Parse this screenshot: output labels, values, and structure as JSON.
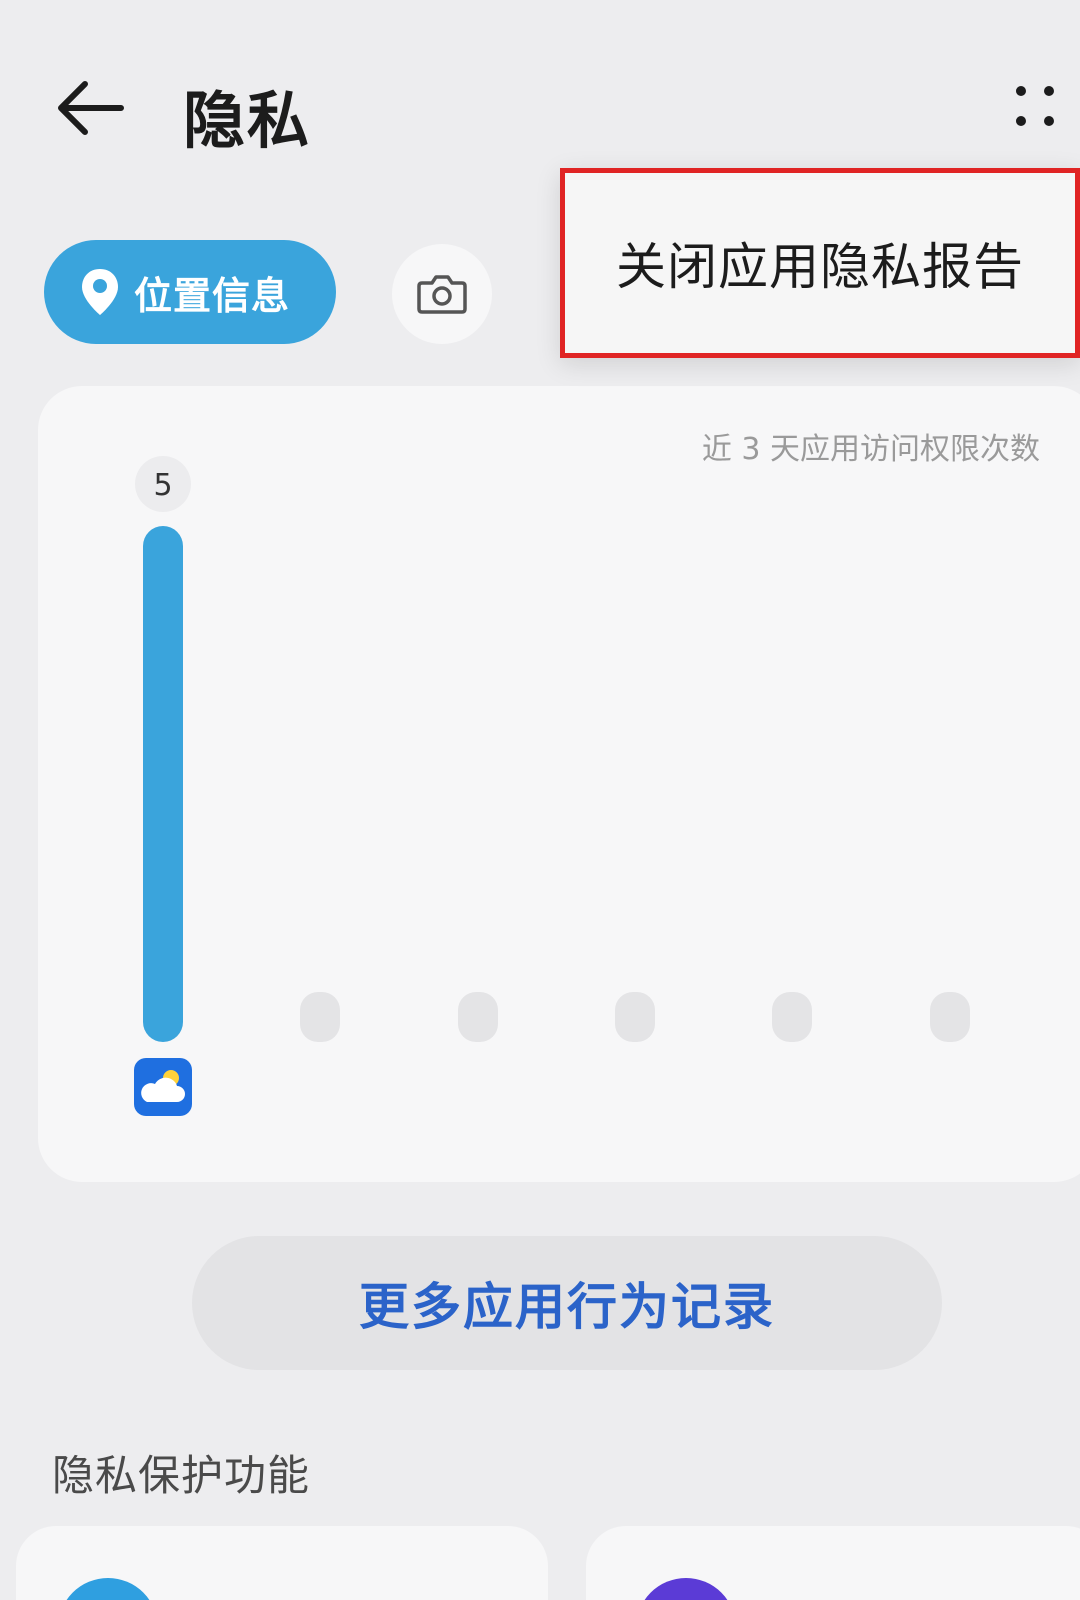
{
  "header": {
    "title": "隐私",
    "back_icon": "arrow-left-icon",
    "more_icon": "more-dots-icon"
  },
  "popup_menu": {
    "items": [
      "关闭应用隐私报告"
    ],
    "highlight_color": "#e02424"
  },
  "permission_tabs": [
    {
      "label": "位置信息",
      "icon": "location-pin-icon",
      "selected": true
    },
    {
      "label": "",
      "icon": "camera-icon",
      "selected": false
    }
  ],
  "chart_data": {
    "type": "bar",
    "title": "近 3 天应用访问权限次数",
    "categories": [
      "weather-app-icon",
      "",
      "",
      "",
      "",
      ""
    ],
    "values": [
      5,
      0,
      0,
      0,
      0,
      0
    ],
    "data_labels": [
      "5"
    ],
    "bar_color": "#3aa4dc",
    "placeholder_color": "#e4e4e6"
  },
  "more_records_button": "更多应用行为记录",
  "section": {
    "title": "隐私保护功能"
  },
  "colors": {
    "accent": "#3aa4dc",
    "link": "#2b63c9",
    "background": "#ededef"
  }
}
